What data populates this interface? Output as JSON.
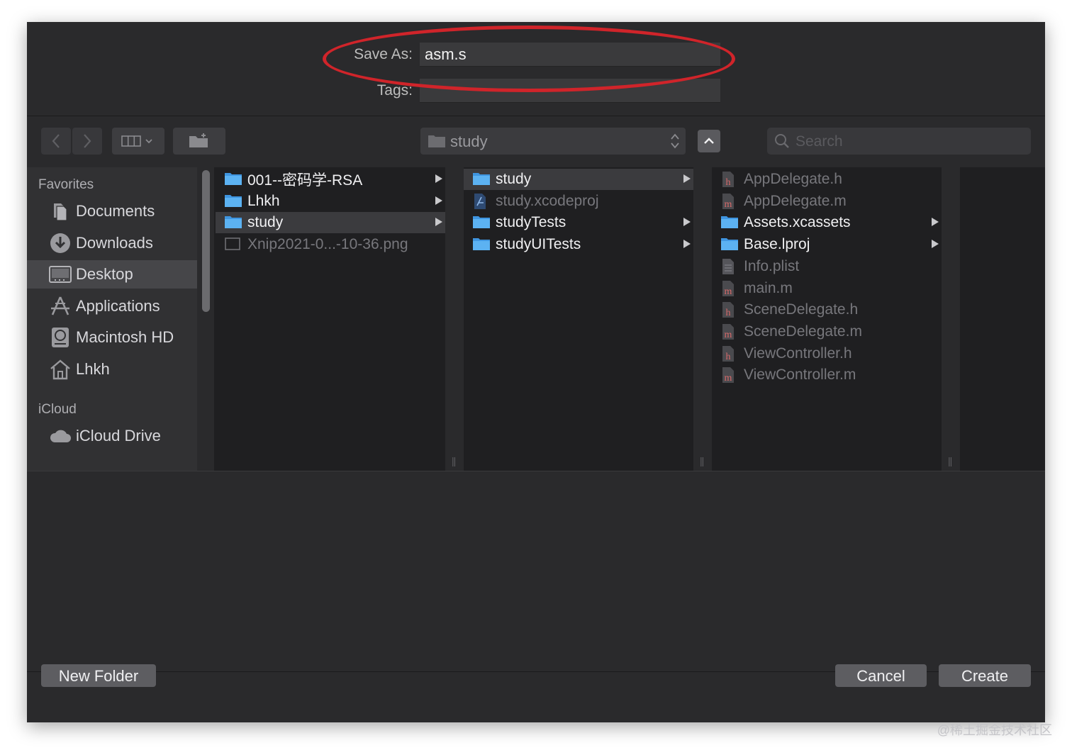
{
  "header": {
    "save_as_label": "Save As:",
    "save_as_value": "asm.s",
    "tags_label": "Tags:",
    "tags_value": ""
  },
  "toolbar": {
    "back_icon": "chevron-left-icon",
    "forward_icon": "chevron-right-icon",
    "view_icon": "column-view-icon",
    "group_icon": "folder-action-icon",
    "path_current": "study",
    "up_icon": "chevron-up-icon",
    "search_placeholder": "Search"
  },
  "sidebar": {
    "sections": [
      {
        "title": "Favorites",
        "items": [
          {
            "label": "Documents",
            "icon": "documents-icon",
            "selected": false
          },
          {
            "label": "Downloads",
            "icon": "downloads-icon",
            "selected": false
          },
          {
            "label": "Desktop",
            "icon": "desktop-icon",
            "selected": true
          },
          {
            "label": "Applications",
            "icon": "applications-icon",
            "selected": false
          },
          {
            "label": "Macintosh HD",
            "icon": "hard-drive-icon",
            "selected": false
          },
          {
            "label": "Lhkh",
            "icon": "home-icon",
            "selected": false
          }
        ]
      },
      {
        "title": "iCloud",
        "items": [
          {
            "label": "iCloud Drive",
            "icon": "cloud-icon",
            "selected": false
          }
        ]
      }
    ]
  },
  "columns": [
    [
      {
        "name": "001--密码学-RSA",
        "type": "folder",
        "selected": false
      },
      {
        "name": "Lhkh",
        "type": "folder",
        "selected": false
      },
      {
        "name": "study",
        "type": "folder",
        "selected": true
      },
      {
        "name": "Xnip2021-0...-10-36.png",
        "type": "image",
        "selected": false
      }
    ],
    [
      {
        "name": "study",
        "type": "folder",
        "selected": true
      },
      {
        "name": "study.xcodeproj",
        "type": "xcodeproj",
        "selected": false
      },
      {
        "name": "studyTests",
        "type": "folder",
        "selected": false
      },
      {
        "name": "studyUITests",
        "type": "folder",
        "selected": false
      }
    ],
    [
      {
        "name": "AppDelegate.h",
        "type": "h",
        "selected": false
      },
      {
        "name": "AppDelegate.m",
        "type": "m",
        "selected": false
      },
      {
        "name": "Assets.xcassets",
        "type": "folder",
        "selected": false
      },
      {
        "name": "Base.lproj",
        "type": "folder",
        "selected": false
      },
      {
        "name": "Info.plist",
        "type": "plist",
        "selected": false
      },
      {
        "name": "main.m",
        "type": "m",
        "selected": false
      },
      {
        "name": "SceneDelegate.h",
        "type": "h",
        "selected": false
      },
      {
        "name": "SceneDelegate.m",
        "type": "m",
        "selected": false
      },
      {
        "name": "ViewController.h",
        "type": "h",
        "selected": false
      },
      {
        "name": "ViewController.m",
        "type": "m",
        "selected": false
      }
    ]
  ],
  "footer": {
    "new_folder_label": "New Folder",
    "cancel_label": "Cancel",
    "create_label": "Create"
  },
  "watermark": "@稀土掘金技术社区",
  "colors": {
    "dialog_bg": "#2a2a2c",
    "sidebar_bg": "#313133",
    "browser_bg": "#1f1f21",
    "folder_blue": "#4aa3e8",
    "highlight_ellipse": "#d0242a"
  }
}
